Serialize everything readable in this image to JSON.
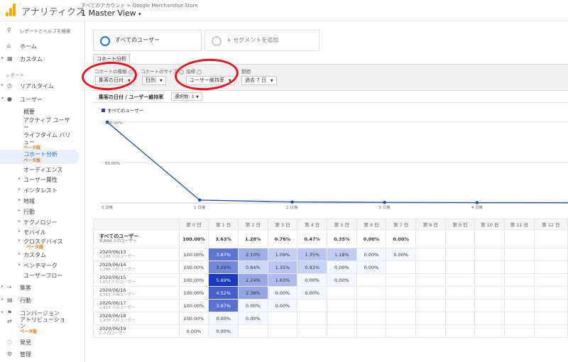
{
  "header": {
    "app_title": "アナリティクス",
    "breadcrumb": "すべてのアカウント > Google Merchandise Store",
    "view": "1 Master View"
  },
  "sidebar": {
    "search": "レポートとヘルプを検索",
    "home": "ホーム",
    "custom": "カスタム",
    "section_reports": "レポート",
    "realtime": "リアルタイム",
    "users": "ユーザー",
    "sub": [
      "概要",
      "アクティブ ユーザー",
      "ライフタイム バリュー",
      "コホート分析",
      "オーディエンス",
      "ユーザー属性",
      "インタレスト",
      "地域",
      "行動",
      "テクノロジー",
      "モバイル",
      "クロスデバイス",
      "カスタム",
      "ベンチマーク",
      "ユーザーフロー"
    ],
    "lifetime_line1": "ライフタイム バリ",
    "lifetime_line2": "ュー",
    "active_line1": "アクティブ ユーザ",
    "active_line2": "ー",
    "beta": "ベータ版",
    "acquisition": "集客",
    "behavior": "行動",
    "conversion_line1": "コンバージョン",
    "conversion_line2": "アトリビューショ",
    "conversion_line3": "ン",
    "discover": "発見",
    "admin": "管理"
  },
  "segments": {
    "all_users": "すべてのユーザー",
    "add_segment": "+ セグメントを追加",
    "colors": {
      "active": "#1a73e8",
      "add": "#cccccc"
    }
  },
  "cohort_tab": "コホート分析",
  "controls": {
    "cohort_type_label": "コホートの種類",
    "cohort_type_value": "集客の日付",
    "cohort_size_label": "コホートのサイズ",
    "cohort_size_value": "日別",
    "metric_label": "指標",
    "metric_value": "ユーザー維持率",
    "range_label": "期間",
    "range_value": "過去 7 日"
  },
  "chart_header": {
    "title": "集客の日付 / ユーザー維持率",
    "select_label": "選択数: 1"
  },
  "chart_data": {
    "type": "line",
    "x": [
      "0 日後",
      "1 日後",
      "2 日後",
      "3 日後",
      "4 日後",
      ""
    ],
    "series": [
      {
        "name": "すべてのユーザー",
        "values": [
          100.0,
          3.63,
          1.28,
          0.76,
          0.47,
          0.35
        ]
      }
    ],
    "y_tick_labels": [
      "100.00%",
      "50.00%"
    ],
    "ylim": [
      0,
      100
    ],
    "color": "#1f4aa8",
    "legend": "top-left",
    "grid": true
  },
  "table": {
    "headers": [
      "",
      "第 0 日",
      "第 1 日",
      "第 2 日",
      "第 3 日",
      "第 4 日",
      "第 5 日",
      "第 6 日",
      "第 7 日",
      "第 8 日",
      "第 9 日",
      "第 10 日",
      "第 11 日",
      "第 12 日"
    ],
    "total": {
      "label": "すべてのユーザー",
      "sub": "8,846 人のユーザー",
      "values": [
        "100.00%",
        "3.63%",
        "1.28%",
        "0.76%",
        "0.47%",
        "0.35%",
        "0.00%",
        "0.00%"
      ]
    },
    "rows": [
      {
        "label": "2020/06/13",
        "sub": "1,188 人のユーザー",
        "values": [
          "100.00%",
          "3.87%",
          "2.10%",
          "1.09%",
          "1.35%",
          "1.18%",
          "0.00%",
          "0.00%"
        ]
      },
      {
        "label": "2020/06/14",
        "sub": "1,188 人のユーザー",
        "values": [
          "100.00%",
          "3.28%",
          "0.84%",
          "1.35%",
          "0.93%",
          "0.00%",
          "0.00%"
        ]
      },
      {
        "label": "2020/06/15",
        "sub": "1,652 人のユーザー",
        "values": [
          "100.00%",
          "5.69%",
          "2.24%",
          "1.63%",
          "0.00%",
          "0.00%"
        ]
      },
      {
        "label": "2020/06/16",
        "sub": "1,725 人のユーザー",
        "values": [
          "100.00%",
          "4.52%",
          "2.38%",
          "0.00%",
          "0.00%"
        ]
      },
      {
        "label": "2020/06/17",
        "sub": "1,614 人のユーザー",
        "values": [
          "100.00%",
          "3.97%",
          "0.00%",
          "0.00%"
        ]
      },
      {
        "label": "2020/06/18",
        "sub": "1,479 人のユーザー",
        "values": [
          "100.00%",
          "0.00%",
          "0.00%"
        ]
      },
      {
        "label": "2020/06/19",
        "sub": "0 人のユーザー",
        "values": [
          "0.00%",
          "0.00%"
        ]
      }
    ]
  }
}
